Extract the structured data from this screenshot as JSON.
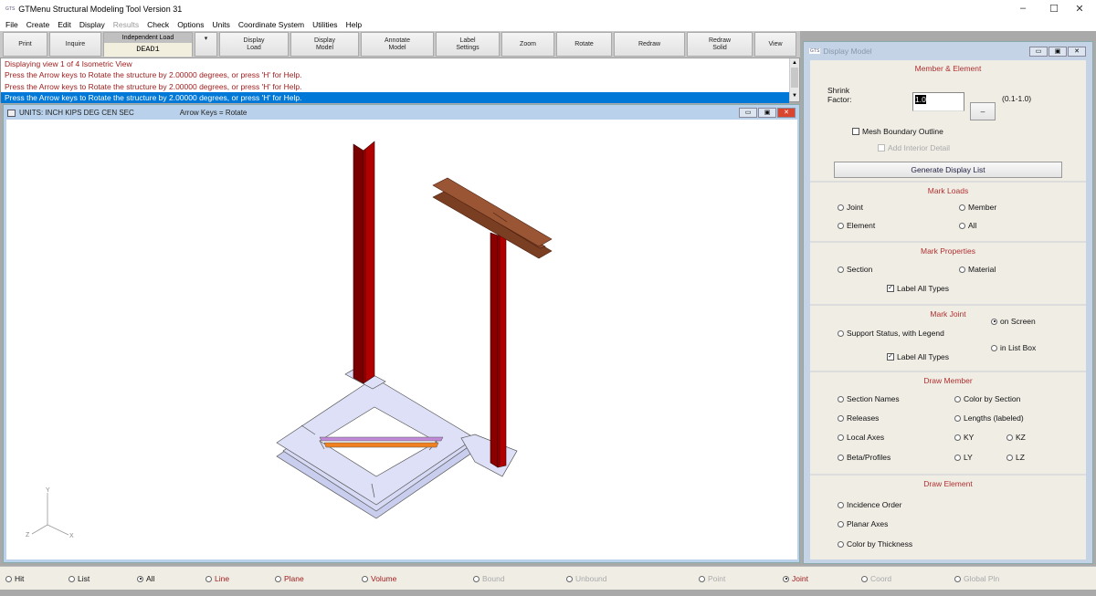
{
  "window": {
    "title": "GTMenu Structural Modeling Tool Version 31",
    "logo": "GTS",
    "controls": [
      "minimize-icon",
      "maximize-icon",
      "close-icon"
    ]
  },
  "menu": [
    "File",
    "Create",
    "Edit",
    "Display",
    "Results",
    "Check",
    "Options",
    "Units",
    "Coordinate System",
    "Utilities",
    "Help"
  ],
  "menu_disabled": [
    "Results"
  ],
  "toolbar": {
    "print": "Print",
    "inquire": "Inquire",
    "load_label": "Independent Load",
    "load_value": "DEAD1",
    "load_arrow": "▾",
    "display_load": "Display\nLoad",
    "display_model": "Display\nModel",
    "annotate_model": "Annotate\nModel",
    "label_settings": "Label\nSettings",
    "zoom": "Zoom",
    "rotate": "Rotate",
    "redraw": "Redraw",
    "redraw_solid": "Redraw\nSolid",
    "view": "View"
  },
  "messages": [
    "Displaying view 1 of 4  Isometric View",
    "Press the Arrow keys to Rotate the structure by 2.00000 degrees, or press 'H' for Help.",
    "Press the Arrow keys to Rotate the structure by 2.00000 degrees, or press 'H' for Help.",
    "Press the Arrow keys to Rotate the structure by 2.00000 degrees, or press 'H' for Help."
  ],
  "graphics": {
    "units": "UNITS:  INCH  KIPS  DEG  CEN  SEC",
    "hint": "Arrow Keys = Rotate",
    "view": "Isometric View",
    "axes": {
      "x": "X",
      "y": "Y",
      "z": "Z"
    }
  },
  "colors": {
    "column": "#a00000",
    "beam": "#8b4a2b",
    "plate": "#d6daf5",
    "brace1": "#c08ad8",
    "brace2": "#f08020",
    "accent_text": "#b03030",
    "selection": "#0078d7"
  },
  "panel": {
    "title": "Display Model",
    "logo": "GTS",
    "member_element": {
      "heading": "Member & Element",
      "shrink_label": "Shrink\nFactor:",
      "shrink_value": "1.0",
      "shrink_range": "(0.1-1.0)",
      "shrink_button": "–",
      "mesh_outline": "Mesh Boundary Outline",
      "interior_detail": "Add Interior Detail",
      "generate": "Generate Display List"
    },
    "mark_loads": {
      "heading": "Mark Loads",
      "joint": "Joint",
      "member": "Member",
      "element": "Element",
      "all": "All"
    },
    "mark_properties": {
      "heading": "Mark Properties",
      "section": "Section",
      "material": "Material",
      "label_all": "Label All Types"
    },
    "mark_joint": {
      "heading": "Mark Joint",
      "support": "Support Status, with Legend",
      "on_screen": "on Screen",
      "list_box": "in List Box",
      "label_all": "Label All Types"
    },
    "draw_member": {
      "heading": "Draw Member",
      "section_names": "Section Names",
      "color_section": "Color by Section",
      "releases": "Releases",
      "lengths": "Lengths (labeled)",
      "local_axes": "Local Axes",
      "ky": "KY",
      "kz": "KZ",
      "beta": "Beta/Profiles",
      "ly": "LY",
      "lz": "LZ"
    },
    "draw_element": {
      "heading": "Draw Element",
      "incidence": "Incidence Order",
      "planar": "Planar Axes",
      "thickness": "Color by Thickness"
    }
  },
  "bottom": [
    {
      "label": "Hit",
      "state": "off",
      "style": "normal"
    },
    {
      "label": "List",
      "state": "off",
      "style": "normal"
    },
    {
      "label": "All",
      "state": "on",
      "style": "normal"
    },
    {
      "label": "Line",
      "state": "off",
      "style": "red"
    },
    {
      "label": "Plane",
      "state": "off",
      "style": "red"
    },
    {
      "label": "Volume",
      "state": "off",
      "style": "red"
    },
    {
      "label": "Bound",
      "state": "off",
      "style": "disabled"
    },
    {
      "label": "Unbound",
      "state": "off",
      "style": "disabled"
    },
    {
      "label": "Point",
      "state": "off",
      "style": "disabled"
    },
    {
      "label": "Joint",
      "state": "on",
      "style": "red"
    },
    {
      "label": "Coord",
      "state": "off",
      "style": "disabled"
    },
    {
      "label": "Global Pln",
      "state": "off",
      "style": "disabled"
    }
  ]
}
